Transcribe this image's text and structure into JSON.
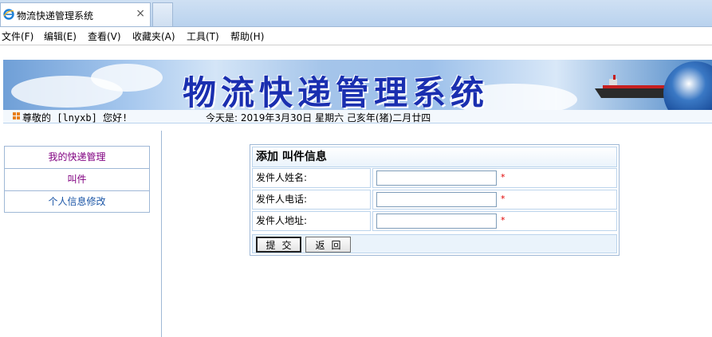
{
  "browser": {
    "tab_title": "物流快递管理系统",
    "close_glyph": "×"
  },
  "menubar": {
    "items": [
      "文件(F)",
      "编辑(E)",
      "查看(V)",
      "收藏夹(A)",
      "工具(T)",
      "帮助(H)"
    ]
  },
  "banner": {
    "title": "物流快递管理系统"
  },
  "welcome": {
    "greeting": "尊敬的 [lnyxb] 您好!",
    "date_text": "今天是:  2019年3月30日 星期六 己亥年(猪)二月廿四"
  },
  "sidebar": {
    "items": [
      {
        "label": "我的快递管理"
      },
      {
        "label": "叫件"
      },
      {
        "label": "个人信息修改"
      }
    ]
  },
  "form": {
    "title": "添加 叫件信息",
    "fields": [
      {
        "label": "发件人姓名:",
        "value": "",
        "required_mark": "*"
      },
      {
        "label": "发件人电话:",
        "value": "",
        "required_mark": "*"
      },
      {
        "label": "发件人地址:",
        "value": "",
        "required_mark": "*"
      }
    ],
    "submit_label": "提交",
    "back_label": "返回"
  },
  "colors": {
    "visited_link": "#800080",
    "link": "#1a55a6",
    "required": "#e00000",
    "border": "#9fb8d6",
    "banner_title": "#1a2fb0"
  },
  "icons": [
    "ie-icon",
    "close-icon",
    "bullet-icon"
  ]
}
